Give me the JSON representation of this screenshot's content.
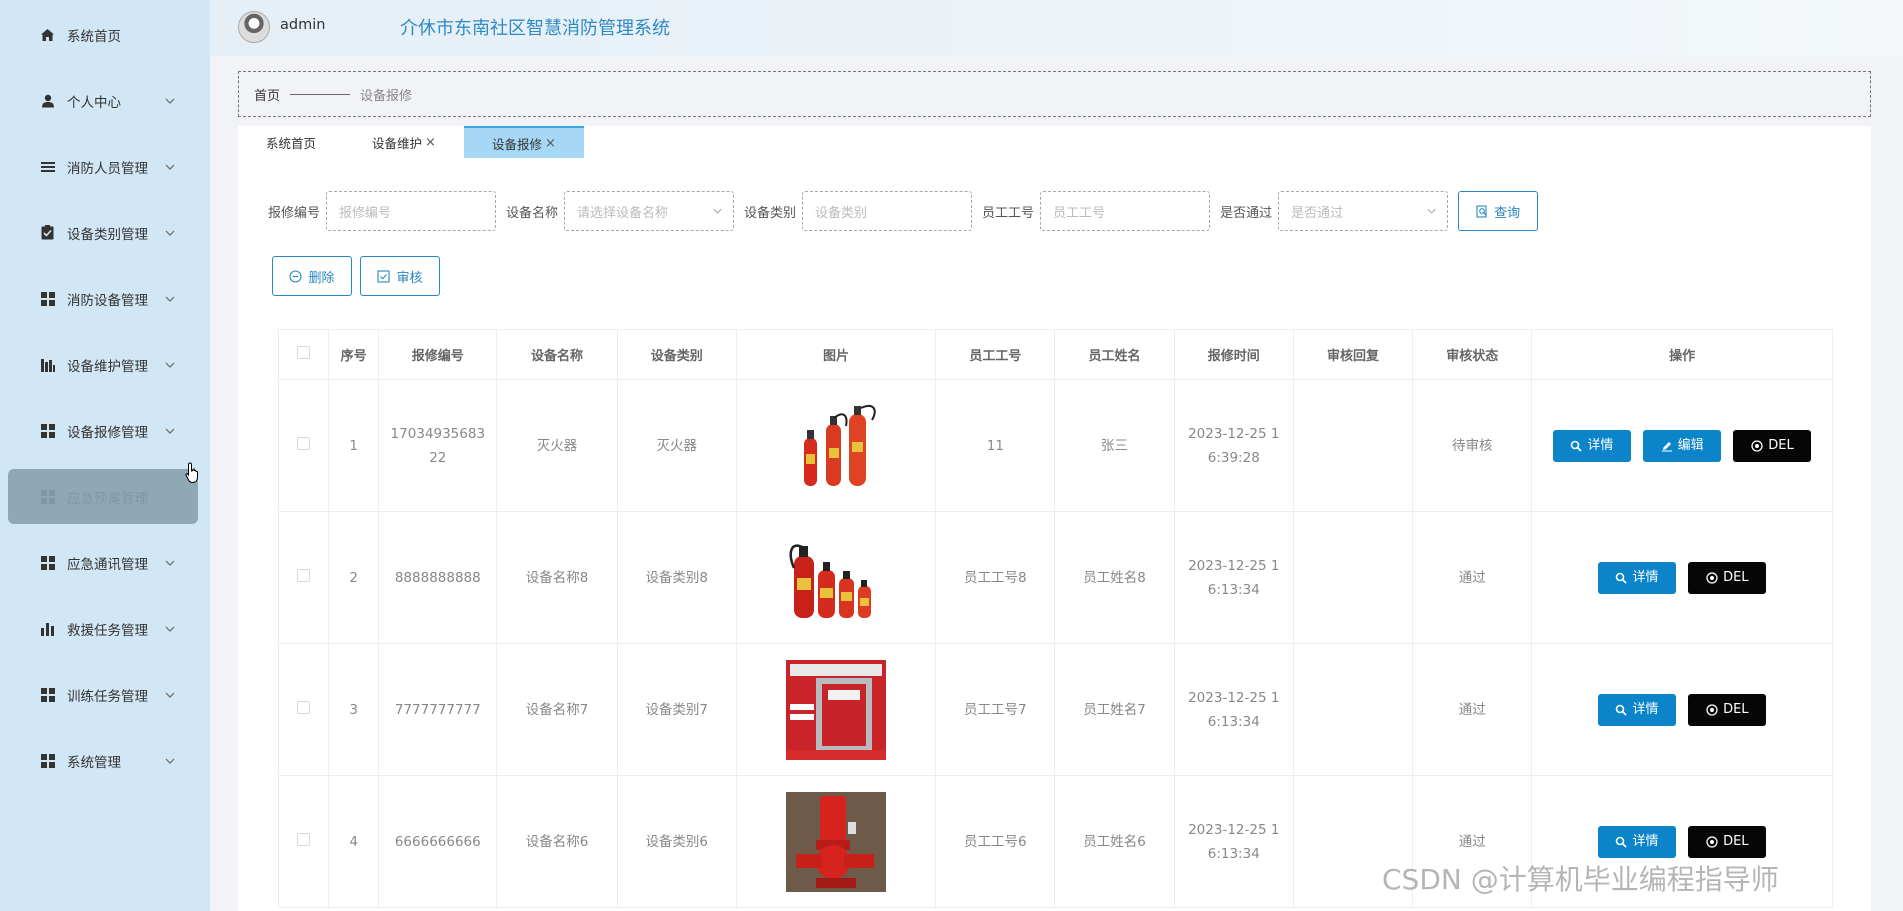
{
  "app": {
    "title": "介休市东南社区智慧消防管理系统",
    "username": "admin"
  },
  "sidebar": {
    "items": [
      {
        "label": "系统首页",
        "icon": "home-icon",
        "has_children": false
      },
      {
        "label": "个人中心",
        "icon": "user-icon",
        "has_children": true
      },
      {
        "label": "消防人员管理",
        "icon": "list-icon",
        "has_children": true
      },
      {
        "label": "设备类别管理",
        "icon": "clipboard-check-icon",
        "has_children": true
      },
      {
        "label": "消防设备管理",
        "icon": "grid-icon",
        "has_children": true
      },
      {
        "label": "设备维护管理",
        "icon": "bar-chart-icon",
        "has_children": true
      },
      {
        "label": "设备报修管理",
        "icon": "grid-icon",
        "has_children": true
      },
      {
        "label": "应急预案管理",
        "icon": "grid-icon",
        "has_children": true,
        "active": true
      },
      {
        "label": "应急通讯管理",
        "icon": "grid-icon",
        "has_children": true
      },
      {
        "label": "救援任务管理",
        "icon": "bar-chart-icon",
        "has_children": true
      },
      {
        "label": "训练任务管理",
        "icon": "grid-icon",
        "has_children": true
      },
      {
        "label": "系统管理",
        "icon": "grid-icon",
        "has_children": true
      }
    ]
  },
  "breadcrumb": {
    "home": "首页",
    "current": "设备报修"
  },
  "tabs": [
    {
      "label": "系统首页",
      "closable": false
    },
    {
      "label": "设备维护",
      "closable": true,
      "close_glyph": "×"
    },
    {
      "label": "设备报修",
      "closable": true,
      "close_glyph": "×",
      "active": true
    }
  ],
  "search": {
    "fields": [
      {
        "label": "报修编号",
        "placeholder": "报修编号",
        "type": "text"
      },
      {
        "label": "设备名称",
        "placeholder": "请选择设备名称",
        "type": "select"
      },
      {
        "label": "设备类别",
        "placeholder": "设备类别",
        "type": "text"
      },
      {
        "label": "员工工号",
        "placeholder": "员工工号",
        "type": "text"
      },
      {
        "label": "是否通过",
        "placeholder": "是否通过",
        "type": "select"
      }
    ],
    "query_label": "查询"
  },
  "actions": {
    "delete_label": "删除",
    "audit_label": "审核"
  },
  "table": {
    "columns": [
      "序号",
      "报修编号",
      "设备名称",
      "设备类别",
      "图片",
      "员工工号",
      "员工姓名",
      "报修时间",
      "审核回复",
      "审核状态",
      "操作"
    ],
    "rows": [
      {
        "index": "1",
        "repair_no": "1703493568322",
        "device_name": "灭火器",
        "device_type": "灭火器",
        "image": "fire-extinguishers-3",
        "staff_no": "11",
        "staff_name": "张三",
        "time": "2023-12-25 16:39:28",
        "reply": "",
        "status": "待审核",
        "ops": [
          "详情",
          "编辑",
          "DEL"
        ]
      },
      {
        "index": "2",
        "repair_no": "8888888888",
        "device_name": "设备名称8",
        "device_type": "设备类别8",
        "image": "fire-extinguishers-4",
        "staff_no": "员工工号8",
        "staff_name": "员工姓名8",
        "time": "2023-12-25 16:13:34",
        "reply": "",
        "status": "通过",
        "ops": [
          "详情",
          "DEL"
        ]
      },
      {
        "index": "3",
        "repair_no": "7777777777",
        "device_name": "设备名称7",
        "device_type": "设备类别7",
        "image": "hydrant-cabinet",
        "staff_no": "员工工号7",
        "staff_name": "员工姓名7",
        "time": "2023-12-25 16:13:34",
        "reply": "",
        "status": "通过",
        "ops": [
          "详情",
          "DEL"
        ]
      },
      {
        "index": "4",
        "repair_no": "6666666666",
        "device_name": "设备名称6",
        "device_type": "设备类别6",
        "image": "fire-pump",
        "staff_no": "员工工号6",
        "staff_name": "员工姓名6",
        "time": "2023-12-25 16:13:34",
        "reply": "",
        "status": "通过",
        "ops": [
          "详情",
          "DEL"
        ]
      }
    ]
  },
  "watermark": "CSDN @计算机毕业编程指导师",
  "colors": {
    "sidebar_bg": "#d1e7f5",
    "primary": "#0b84c9",
    "del": "#060606",
    "title": "#2e8ac7",
    "active_tab": "#a6d8f6"
  }
}
